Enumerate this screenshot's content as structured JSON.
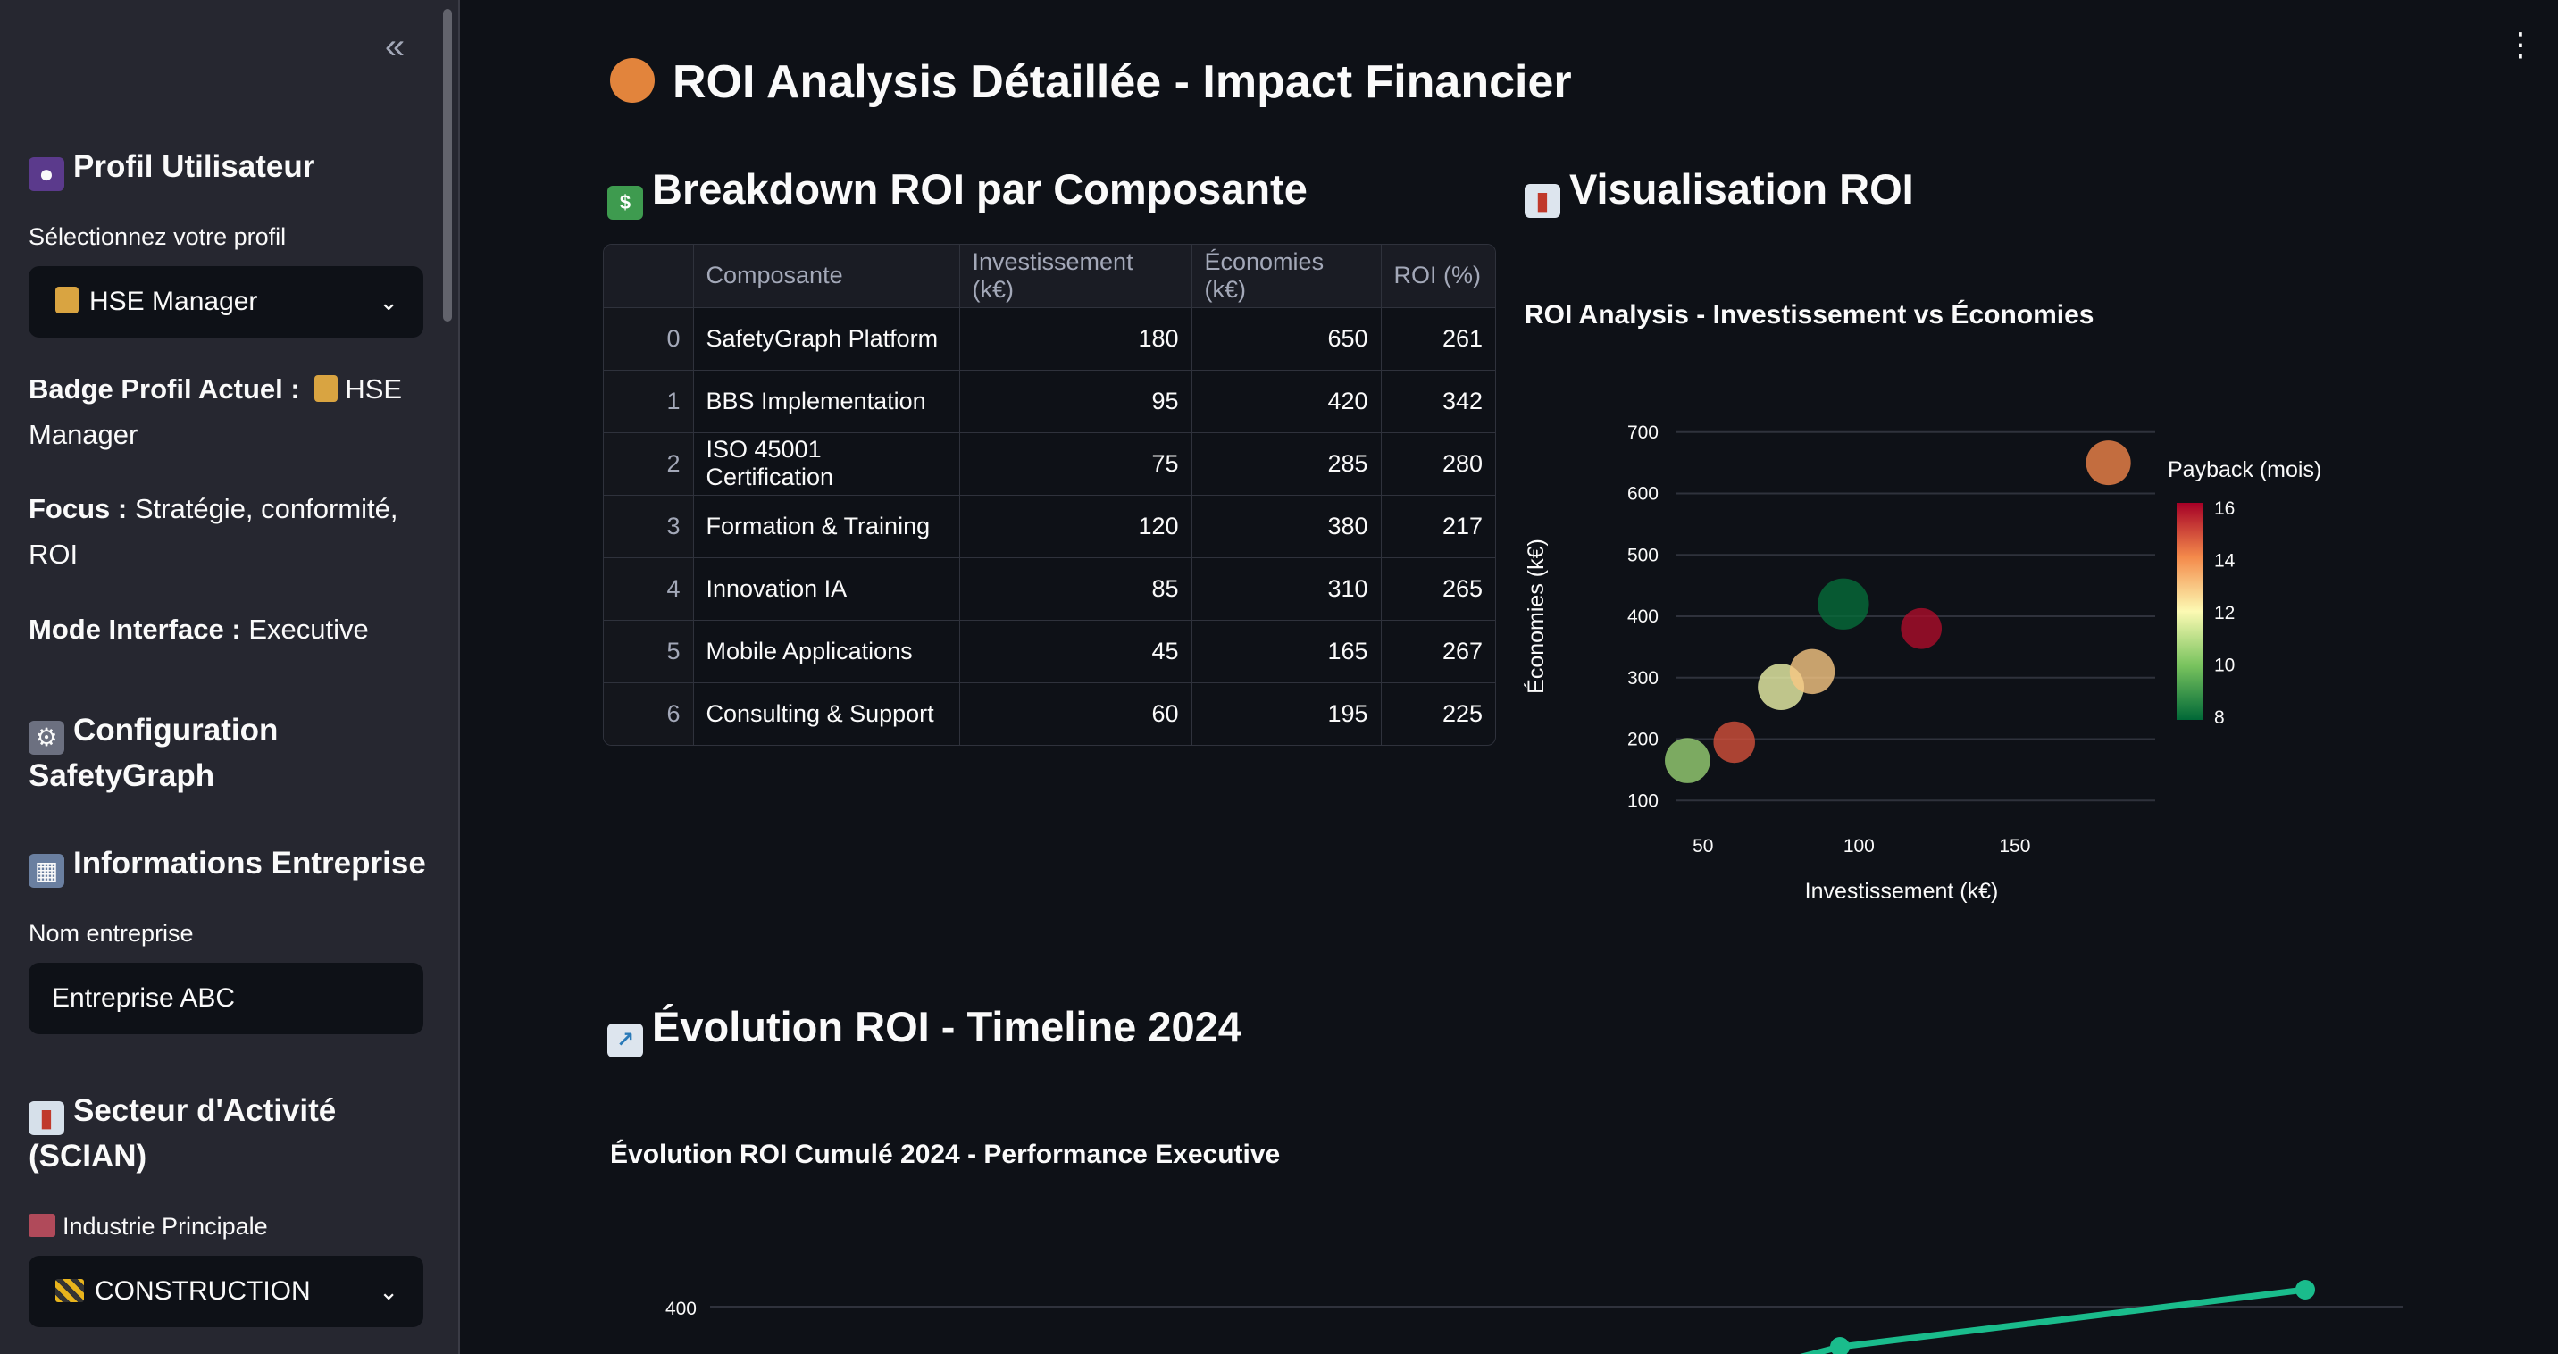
{
  "sidebar": {
    "collapse_icon": "«",
    "profile_heading": "Profil Utilisateur",
    "profile_select_label": "Sélectionnez votre profil",
    "profile_select_value": "HSE Manager",
    "badge_label": "Badge Profil Actuel :",
    "badge_value": "HSE Manager",
    "focus_label": "Focus :",
    "focus_value": "Stratégie, conformité, ROI",
    "mode_label": "Mode Interface :",
    "mode_value": "Executive",
    "config_heading": "Configuration SafetyGraph",
    "company_heading": "Informations Entreprise",
    "company_name_label": "Nom entreprise",
    "company_name_value": "Entreprise ABC",
    "sector_heading": "Secteur d'Activité (SCIAN)",
    "industry_label": "Industrie Principale",
    "industry_value": "CONSTRUCTION"
  },
  "main": {
    "cut_title": "ROI Analysis Détaillée - Impact Financier",
    "breakdown_heading": "Breakdown ROI par Composante",
    "viz_heading": "Visualisation ROI",
    "evolution_heading": "Évolution ROI - Timeline 2024"
  },
  "table": {
    "headers": [
      "",
      "Composante",
      "Investissement (k€)",
      "Économies (k€)",
      "ROI (%)"
    ],
    "rows": [
      [
        "0",
        "SafetyGraph Platform",
        "180",
        "650",
        "261"
      ],
      [
        "1",
        "BBS Implementation",
        "95",
        "420",
        "342"
      ],
      [
        "2",
        "ISO 45001 Certification",
        "75",
        "285",
        "280"
      ],
      [
        "3",
        "Formation & Training",
        "120",
        "380",
        "217"
      ],
      [
        "4",
        "Innovation IA",
        "85",
        "310",
        "265"
      ],
      [
        "5",
        "Mobile Applications",
        "45",
        "165",
        "267"
      ],
      [
        "6",
        "Consulting & Support",
        "60",
        "195",
        "225"
      ]
    ]
  },
  "chart_data": [
    {
      "type": "scatter",
      "title": "ROI Analysis - Investissement vs Économies",
      "xlabel": "Investissement (k€)",
      "ylabel": "Économies (k€)",
      "xlim": [
        30,
        195
      ],
      "ylim": [
        80,
        720
      ],
      "xticks": [
        50,
        100,
        150
      ],
      "yticks": [
        100,
        200,
        300,
        400,
        500,
        600,
        700
      ],
      "colorbar": {
        "title": "Payback (mois)",
        "ticks": [
          8,
          10,
          12,
          14,
          16
        ],
        "range": [
          7.9,
          16.2
        ]
      },
      "points": [
        {
          "x": 180,
          "y": 650,
          "payback": 14.2,
          "size": 261
        },
        {
          "x": 95,
          "y": 420,
          "payback": 8.0,
          "size": 342
        },
        {
          "x": 75,
          "y": 285,
          "payback": 11.8,
          "size": 280
        },
        {
          "x": 120,
          "y": 380,
          "payback": 16.0,
          "size": 217
        },
        {
          "x": 85,
          "y": 310,
          "payback": 13.0,
          "size": 265
        },
        {
          "x": 45,
          "y": 165,
          "payback": 10.5,
          "size": 267
        },
        {
          "x": 60,
          "y": 195,
          "payback": 15.0,
          "size": 225
        }
      ]
    },
    {
      "type": "line",
      "title": "Évolution ROI Cumulé 2024 - Performance Executive",
      "yticks": [
        400
      ],
      "color": "#1abc8c"
    }
  ]
}
